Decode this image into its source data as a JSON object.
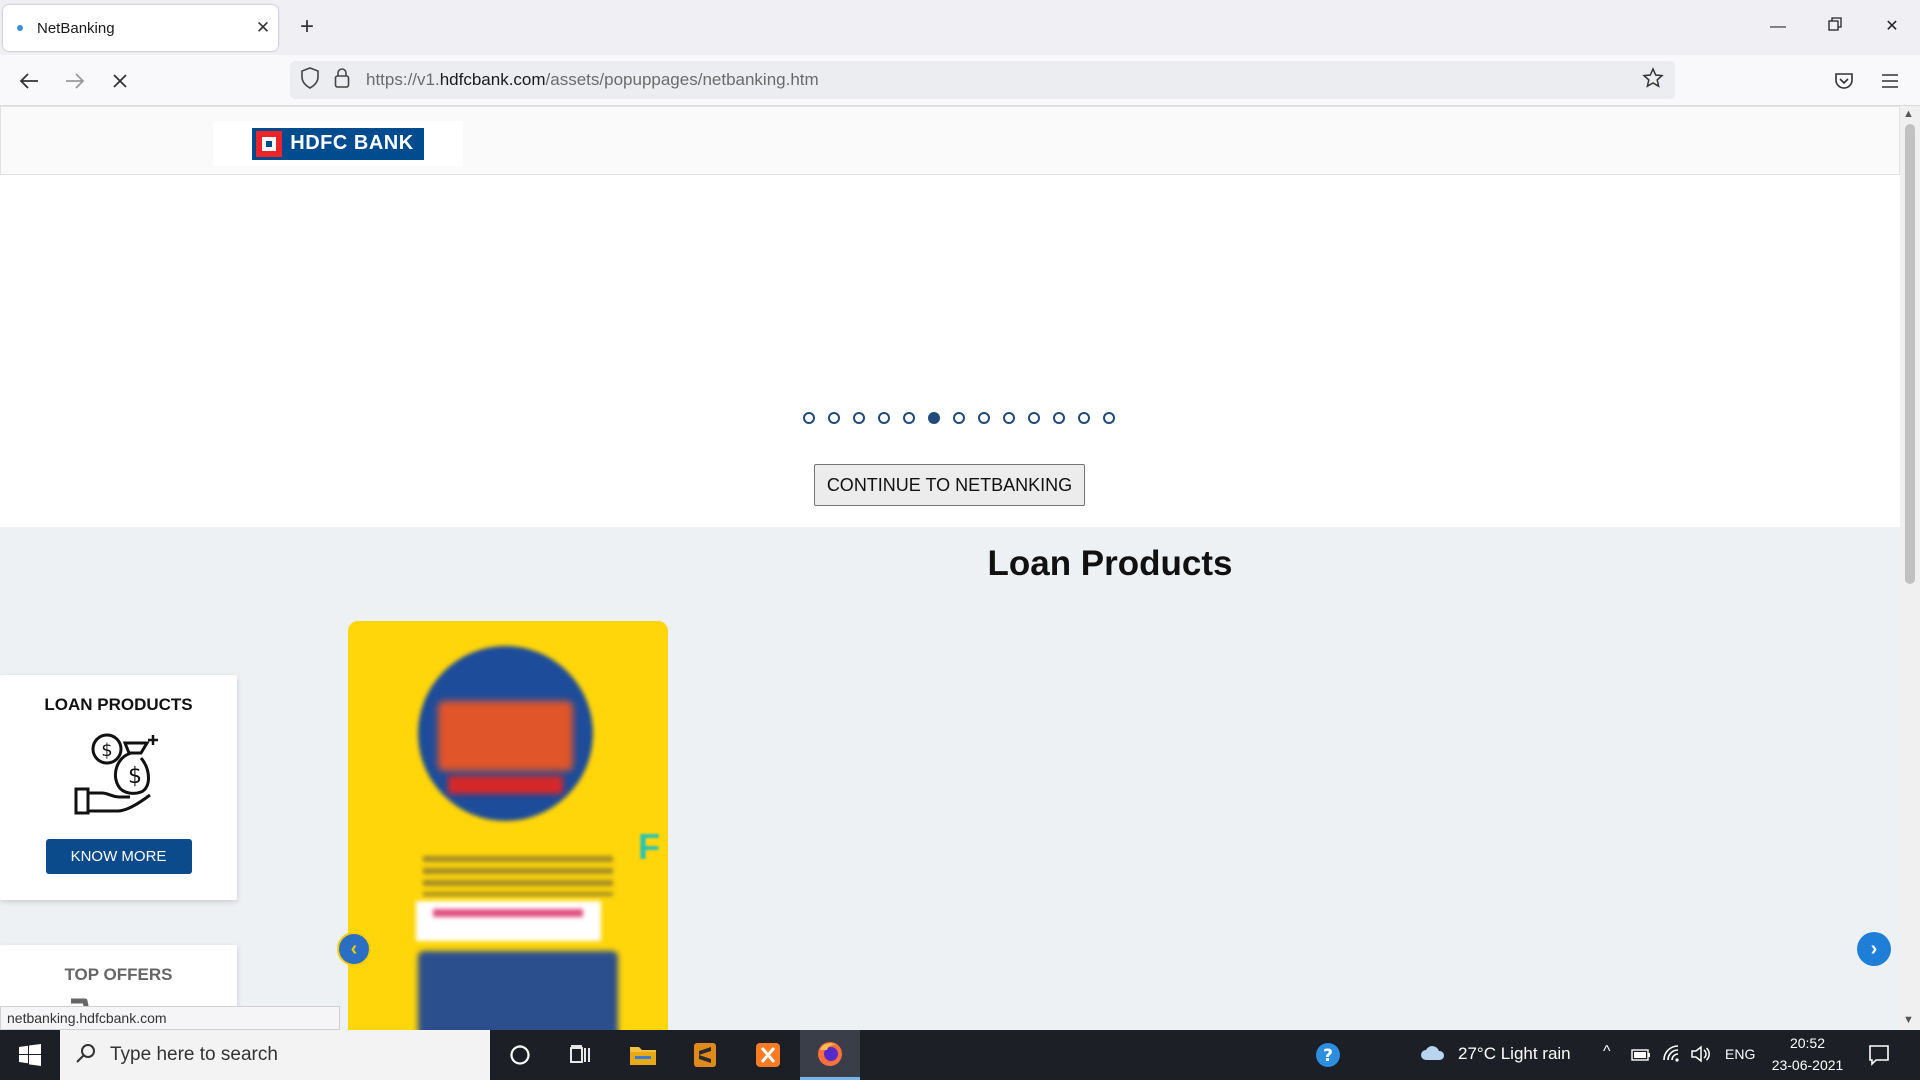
{
  "browser": {
    "tab_title": "NetBanking",
    "url_prefix": "https://v1.",
    "url_domain": "hdfcbank.com",
    "url_path": "/assets/popuppages/netbanking.htm"
  },
  "page": {
    "logo_text": "HDFC BANK",
    "carousel_total": 13,
    "carousel_active": 6,
    "continue_label": "CONTINUE TO NETBANKING",
    "section_title": "Loan Products",
    "loan_card": {
      "title": "LOAN PRODUCTS",
      "button": "KNOW MORE"
    },
    "offers_card": {
      "title": "TOP OFFERS"
    },
    "status_url": "netbanking.hdfcbank.com"
  },
  "taskbar": {
    "search_placeholder": "Type here to search",
    "weather": "27°C  Light rain",
    "language": "ENG",
    "time": "20:52",
    "date": "23-06-2021"
  },
  "colors": {
    "brand_blue": "#004c8f",
    "brand_red": "#ed232a",
    "section_bg": "#eef1f4"
  }
}
